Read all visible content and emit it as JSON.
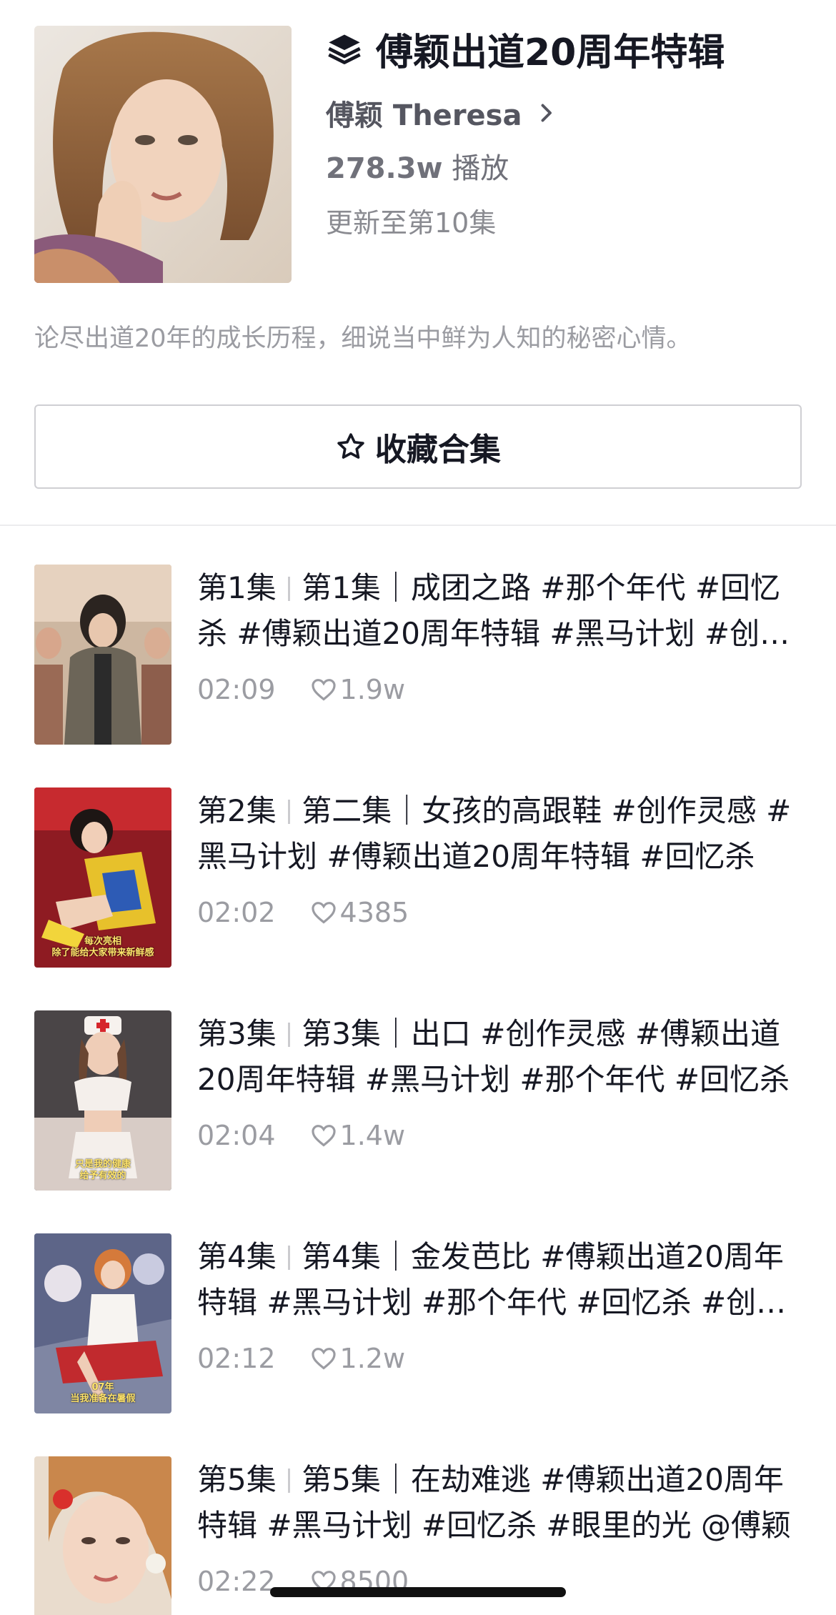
{
  "album": {
    "title": "傅颖出道20周年特辑",
    "author": "傅颖 Theresa",
    "plays_num": "278.3w",
    "plays_label": "播放",
    "updated": "更新至第10集",
    "description": "论尽出道20年的成长历程，细说当中鲜为人知的秘密心情。",
    "collect_label": "收藏合集"
  },
  "episodes": [
    {
      "ep": "第1集",
      "title": "第1集｜成团之路 #那个年代 #回忆杀 #傅颖出道20周年特辑 #黑马计划 #创作灵感",
      "duration": "02:09",
      "likes": "1.9w",
      "caption": ""
    },
    {
      "ep": "第2集",
      "title": "第二集｜女孩的高跟鞋 #创作灵感 #黑马计划 #傅颖出道20周年特辑 #回忆杀",
      "duration": "02:02",
      "likes": "4385",
      "caption": "每次亮相\n除了能给大家带来新鲜感"
    },
    {
      "ep": "第3集",
      "title": "第3集｜出口 #创作灵感 #傅颖出道20周年特辑 #黑马计划 #那个年代 #回忆杀",
      "duration": "02:04",
      "likes": "1.4w",
      "caption": "只是我的健康\n给予有效的"
    },
    {
      "ep": "第4集",
      "title": "第4集｜金发芭比 #傅颖出道20周年特辑 #黑马计划 #那个年代 #回忆杀 #创作灵感",
      "duration": "02:12",
      "likes": "1.2w",
      "caption": "07年\n当我准备在暑假"
    },
    {
      "ep": "第5集",
      "title": "第5集｜在劫难逃 #傅颖出道20周年特辑 #黑马计划 #回忆杀 #眼里的光 @傅颖",
      "duration": "02:22",
      "likes": "8500",
      "caption": ""
    }
  ],
  "icons": {
    "layers": "layers-icon",
    "chevron": "chevron-right-icon",
    "star": "star-outline-icon",
    "heart": "heart-outline-icon"
  }
}
